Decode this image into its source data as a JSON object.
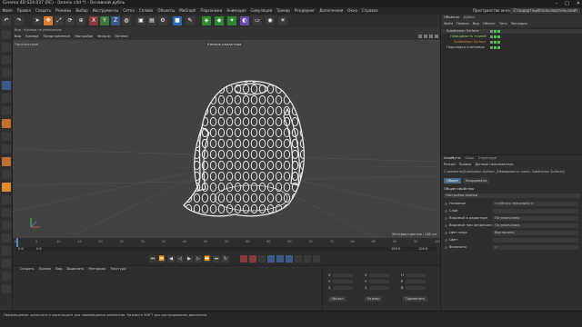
{
  "window": {
    "title": "Cinema 4D S24.037 (RC) - [bronix c4d *] - Основной дубль",
    "controls": [
      "–",
      "□",
      "✕"
    ]
  },
  "menubar": {
    "items": [
      "Файл",
      "Правка",
      "Создать",
      "Режимы",
      "Выбор",
      "Инструменты",
      "Сетка",
      "Сплайн",
      "Объекты",
      "MoGraph",
      "Персонажи",
      "Анимация",
      "Симуляция",
      "Трекер",
      "Рендеринг",
      "Дополнения",
      "Окно",
      "Справка"
    ],
    "layout_label": "Пространство окна:",
    "layout_value": "Стандартный(пользовательский)"
  },
  "topbar": {
    "icons": [
      {
        "name": "undo-icon",
        "glyph": "↶",
        "color": "#3a3a3a"
      },
      {
        "name": "redo-icon",
        "glyph": "↷",
        "color": "#3a3a3a"
      },
      {
        "name": "live-select-icon",
        "glyph": "➤",
        "color": "#3a3a3a"
      },
      {
        "name": "move-icon",
        "glyph": "✥",
        "color": "#e07a2b"
      },
      {
        "name": "scale-icon",
        "glyph": "⤢",
        "color": "#3a3a3a"
      },
      {
        "name": "rotate-icon",
        "glyph": "⟳",
        "color": "#3a3a3a"
      },
      {
        "name": "recent-tools-icon",
        "glyph": "⊕",
        "color": "#3a3a3a"
      },
      {
        "name": "x-axis-icon",
        "glyph": "X",
        "color": "#8a3a3a"
      },
      {
        "name": "y-axis-icon",
        "glyph": "Y",
        "color": "#3a7a3a"
      },
      {
        "name": "z-axis-icon",
        "glyph": "Z",
        "color": "#3a5a8a"
      },
      {
        "name": "world-coords-icon",
        "glyph": "◍",
        "color": "#3a3a3a"
      },
      {
        "name": "render-view-icon",
        "glyph": "▣",
        "color": "#3a3a3a"
      },
      {
        "name": "render-picture-icon",
        "glyph": "▤",
        "color": "#3a3a3a"
      },
      {
        "name": "render-settings-icon",
        "glyph": "⚙",
        "color": "#3a3a3a"
      },
      {
        "name": "cube-icon",
        "glyph": "■",
        "color": "#2a6ab0"
      },
      {
        "name": "pen-icon",
        "glyph": "✎",
        "color": "#3a3a3a"
      },
      {
        "name": "subdivision-icon",
        "glyph": "◈",
        "color": "#2f8a2f"
      },
      {
        "name": "array-icon",
        "glyph": "◆",
        "color": "#2f8a2f"
      },
      {
        "name": "cloner-icon",
        "glyph": "✦",
        "color": "#2f8a2f"
      },
      {
        "name": "deformer-icon",
        "glyph": "◐",
        "color": "#6a4ab0"
      },
      {
        "name": "floor-icon",
        "glyph": "▭",
        "color": "#3a3a3a"
      },
      {
        "name": "camera-icon",
        "glyph": "◉",
        "color": "#3a3a3a"
      },
      {
        "name": "light-icon",
        "glyph": "☀",
        "color": "#3a3a3a"
      }
    ]
  },
  "lefttools": {
    "icons": [
      {
        "name": "make-editable-icon",
        "color": "#3a3a3a"
      },
      {
        "name": "model-mode-icon",
        "color": "#3a3a3a"
      },
      {
        "name": "texture-mode-icon",
        "color": "#3a3a3a"
      },
      {
        "name": "workplane-icon",
        "color": "#3a3a3a"
      },
      {
        "name": "points-mode-icon",
        "color": "#3a5a8a"
      },
      {
        "name": "edges-mode-icon",
        "color": "#3a3a3a"
      },
      {
        "name": "polygons-mode-icon",
        "color": "#3a3a3a"
      },
      {
        "name": "axis-mode-icon",
        "color": "#c07030"
      },
      {
        "name": "tweak-mode-icon",
        "color": "#3a3a3a"
      },
      {
        "name": "solo-icon",
        "color": "#3a3a3a"
      },
      {
        "name": "snap-icon",
        "color": "#c07030"
      },
      {
        "name": "lock-icon",
        "color": "#3a3a3a"
      },
      {
        "name": "sculpt-icon",
        "color": "#e08a2b"
      },
      {
        "name": "paint-icon",
        "color": "#3a3a3a"
      },
      {
        "name": "uv-icon",
        "color": "#3a3a3a"
      },
      {
        "name": "grid-icon",
        "color": "#3a3a3a"
      },
      {
        "name": "guide-icon",
        "color": "#3a3a3a"
      },
      {
        "name": "measure-icon",
        "color": "#3a3a3a"
      },
      {
        "name": "script-icon",
        "color": "#3a3a3a"
      },
      {
        "name": "python-icon",
        "color": "#3a3a3a"
      },
      {
        "name": "help-icon",
        "color": "#3a3a3a"
      }
    ]
  },
  "viewport": {
    "breadcrumb": "Вид  ·  Камера по умолчанию",
    "menu": [
      "Вид",
      "Камера",
      "Представление",
      "Настройки",
      "Фильтр",
      "Панели"
    ],
    "name": "Перспектива",
    "camera": "Камера редактора",
    "grid_info": "Интервал растра : 100 см"
  },
  "timeline": {
    "ticks": [
      "0",
      "5",
      "10",
      "15",
      "20",
      "25",
      "30",
      "35",
      "40",
      "45",
      "50",
      "55",
      "60",
      "65",
      "70",
      "75",
      "80",
      "85",
      "90",
      "95",
      "100"
    ],
    "start": "0 K",
    "current": "0 K",
    "end": "100 K",
    "end2": "100 K",
    "frame_label": "0 K"
  },
  "transport": {
    "buttons": [
      {
        "name": "first-frame-icon",
        "glyph": "⏮"
      },
      {
        "name": "prev-key-icon",
        "glyph": "⏪"
      },
      {
        "name": "prev-frame-icon",
        "glyph": "◀"
      },
      {
        "name": "play-backward-icon",
        "glyph": "◁"
      },
      {
        "name": "play-icon",
        "glyph": "▶"
      },
      {
        "name": "next-frame-icon",
        "glyph": "▷"
      },
      {
        "name": "next-key-icon",
        "glyph": "⏩"
      },
      {
        "name": "last-frame-icon",
        "glyph": "⏭"
      },
      {
        "name": "loop-icon",
        "glyph": "↻"
      }
    ]
  },
  "materials": {
    "menu": [
      "Создать",
      "Правка",
      "Вид",
      "Выделить",
      "Материал",
      "Текстура"
    ]
  },
  "coords": {
    "rows": [
      {
        "a": "X",
        "av": "",
        "b": "X",
        "bv": "",
        "c": "H",
        "cv": ""
      },
      {
        "a": "Y",
        "av": "",
        "b": "Y",
        "bv": "",
        "c": "P",
        "cv": ""
      },
      {
        "a": "Z",
        "av": "",
        "b": "Z",
        "bv": "",
        "c": "B",
        "cv": ""
      }
    ],
    "mode": "Объект",
    "size": "Размер",
    "apply": "Применить"
  },
  "objects": {
    "tabs": [
      "Объекты",
      "Дубли"
    ],
    "menu": [
      "Файл",
      "Правка",
      "Вид",
      "Объект",
      "Теги",
      "Закладки"
    ],
    "rows": [
      {
        "name": "Subdivision Surface",
        "indent": 1,
        "color": "#c8c8c8",
        "active": true
      },
      {
        "name": "Невидимость тканей",
        "indent": 2,
        "color": "#9acf6a",
        "active": true
      },
      {
        "name": "Subdivision Surface",
        "indent": 3,
        "color": "#e08a2b",
        "active": true
      },
      {
        "name": "Подкладка платьеврь",
        "indent": 1,
        "color": "#c8c8c8",
        "active": false
      }
    ]
  },
  "attributes": {
    "tabs": [
      "Атрибуты",
      "Слои",
      "Структура"
    ],
    "menu": [
      "Режим",
      "Правка",
      "Данные пользователя"
    ],
    "selection": "2 элементы(Subdivision Surface, [Невидимость ткани, Subdivision Surface])",
    "subtabs": [
      "Общее",
      "Координаты"
    ],
    "section": "Общие свойства",
    "group": "Настройки иконки",
    "props": [
      {
        "label": "Название",
        "value": "<<Много значений>>"
      },
      {
        "label": "Слой",
        "value": ""
      },
      {
        "label": "Видимый в редакторе",
        "value": "По умолчанию"
      },
      {
        "label": "Видимый при рендеринге",
        "value": "По умолчанию"
      },
      {
        "label": "Цвет вида",
        "value": "Выключено"
      },
      {
        "label": "Цвет",
        "value": ""
      },
      {
        "label": "Включено",
        "value": "✓"
      }
    ]
  },
  "status": {
    "text": "Перемещение: щёлкните и перетащите для перемещения элементов. Нажмите SHIFT для растрирования движения."
  }
}
